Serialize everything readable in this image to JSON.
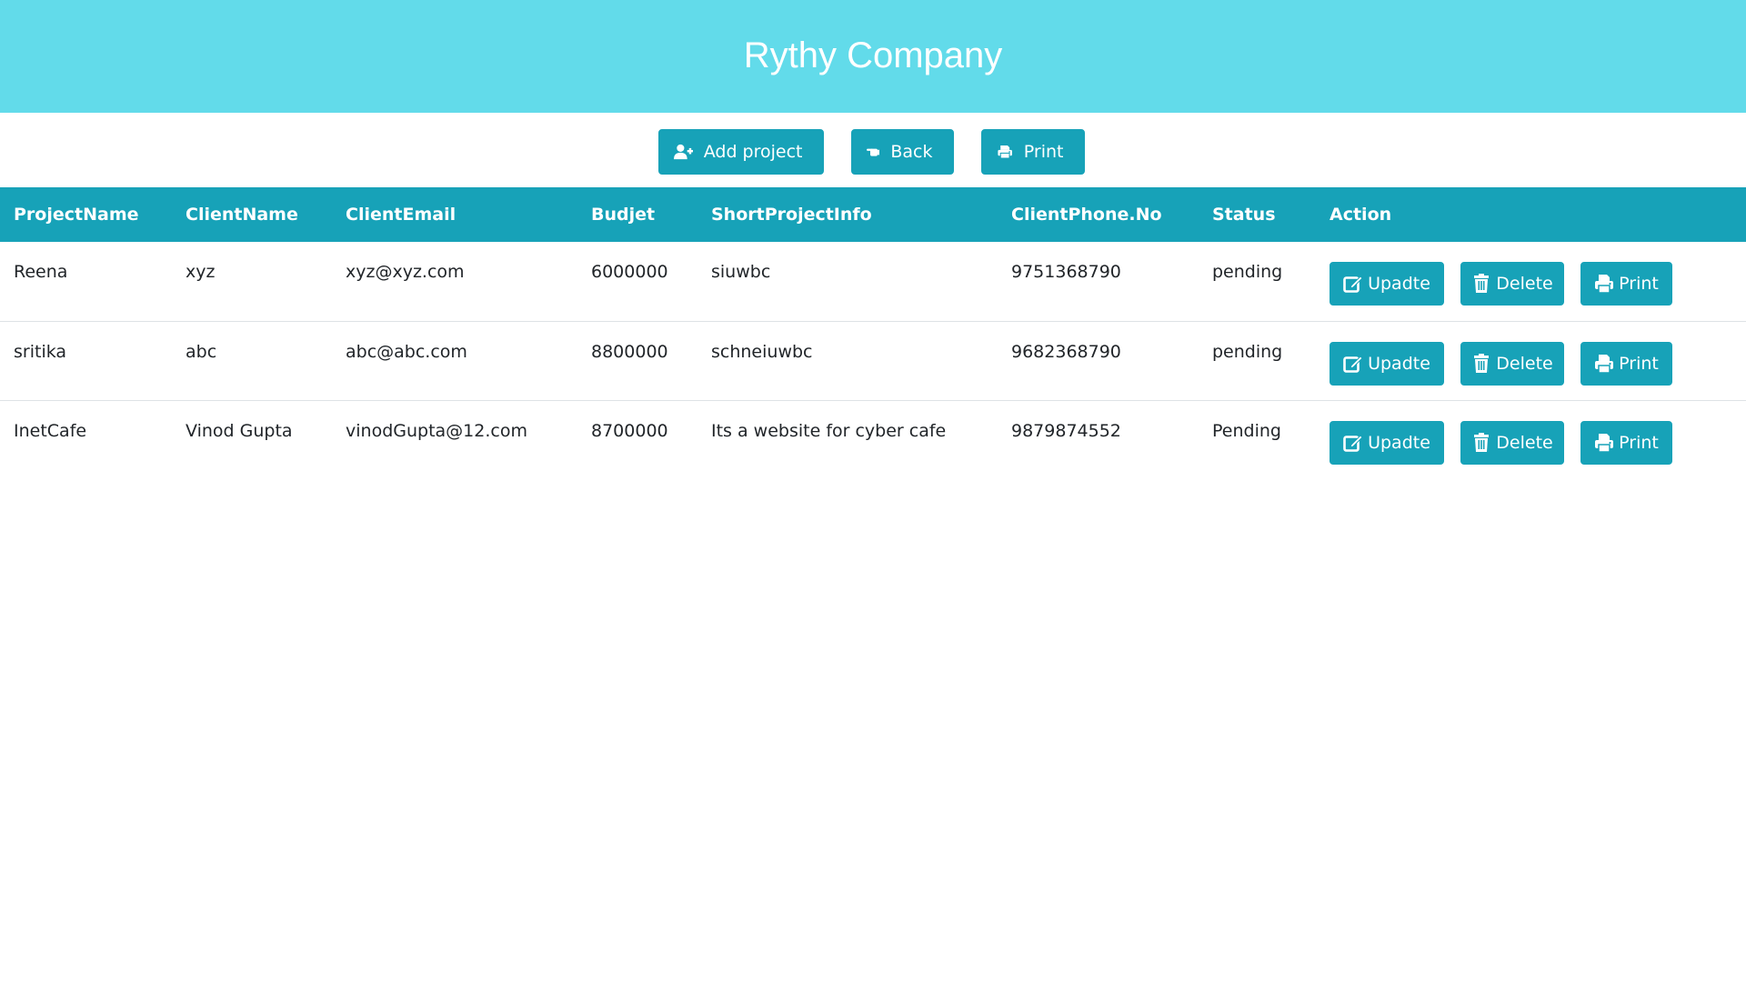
{
  "header": {
    "title": "Rythy Company",
    "background": "#62dbea"
  },
  "toolbar": {
    "add_label": "Add project",
    "back_label": "Back",
    "print_label": "Print"
  },
  "accent_color": "#17a2b8",
  "table": {
    "columns": [
      "ProjectName",
      "ClientName",
      "ClientEmail",
      "Budjet",
      "ShortProjectInfo",
      "ClientPhone.No",
      "Status",
      "Action"
    ],
    "rows": [
      {
        "project_name": "Reena",
        "client_name": "xyz",
        "client_email": "xyz@xyz.com",
        "budget": "6000000",
        "info": "siuwbc",
        "phone": "9751368790",
        "status": "pending"
      },
      {
        "project_name": "sritika",
        "client_name": "abc",
        "client_email": "abc@abc.com",
        "budget": "8800000",
        "info": "schneiuwbc",
        "phone": "9682368790",
        "status": "pending"
      },
      {
        "project_name": "InetCafe",
        "client_name": "Vinod Gupta",
        "client_email": "vinodGupta@12.com",
        "budget": "8700000",
        "info": "Its a website for cyber cafe",
        "phone": "9879874552",
        "status": "Pending"
      }
    ],
    "row_actions": {
      "update_label": "Upadte",
      "delete_label": "Delete",
      "print_label": "Print"
    }
  },
  "icons": {
    "add": "user-plus-icon",
    "back": "hand-point-left-icon",
    "print": "print-icon",
    "update": "edit-icon",
    "delete": "trash-icon"
  }
}
